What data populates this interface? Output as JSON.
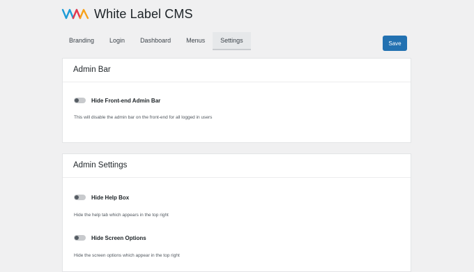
{
  "app": {
    "title": "White Label CMS",
    "logo_icon": "wlcms-logo-icon",
    "brand_colors": [
      "#1e9cd7",
      "#e8374d",
      "#f7a21b"
    ]
  },
  "tabs": [
    {
      "label": "Branding",
      "active": false
    },
    {
      "label": "Login",
      "active": false
    },
    {
      "label": "Dashboard",
      "active": false
    },
    {
      "label": "Menus",
      "active": false
    },
    {
      "label": "Settings",
      "active": true
    }
  ],
  "save_label": "Save",
  "accent_color": "#2271b1",
  "panels": {
    "admin_bar": {
      "title": "Admin Bar",
      "settings": [
        {
          "label": "Hide Front-end Admin Bar",
          "description": "This will disable the admin bar on the front-end for all logged in users",
          "enabled": false
        }
      ]
    },
    "admin_settings": {
      "title": "Admin Settings",
      "settings": [
        {
          "label": "Hide Help Box",
          "description": "Hide the help tab which appears in the top right",
          "enabled": false
        },
        {
          "label": "Hide Screen Options",
          "description": "Hide the screen options which appear in the top right",
          "enabled": false
        }
      ]
    }
  }
}
